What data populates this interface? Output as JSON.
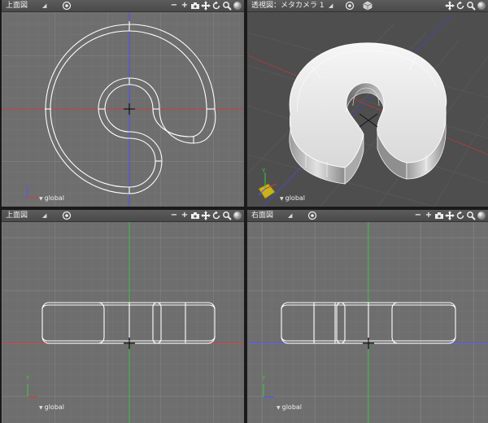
{
  "viewports": {
    "top_left": {
      "title": "上面図",
      "axis_label": "global"
    },
    "top_right": {
      "title": "透視図：メタカメラ 1",
      "axis_label": "global"
    },
    "bottom_left": {
      "title": "上面図",
      "axis_label": "global"
    },
    "bottom_right": {
      "title": "右面図",
      "axis_label": "global"
    }
  },
  "tools": {
    "minus": "−",
    "plus": "+",
    "camera": "camera-icon",
    "move": "move-icon",
    "rotate": "rotate-icon",
    "zoom": "zoom-icon",
    "sphere": "shading-sphere-icon"
  },
  "colors": {
    "viewport_bg": "#6e6e6e",
    "grid_minor": "#7c7c7c",
    "grid_major": "#8a8a8a",
    "x_axis": "#d23c3c",
    "y_axis": "#3cc83c",
    "z_axis": "#5050ff",
    "wire": "#ffffff",
    "perspective_bg": "#4e4e4e"
  }
}
